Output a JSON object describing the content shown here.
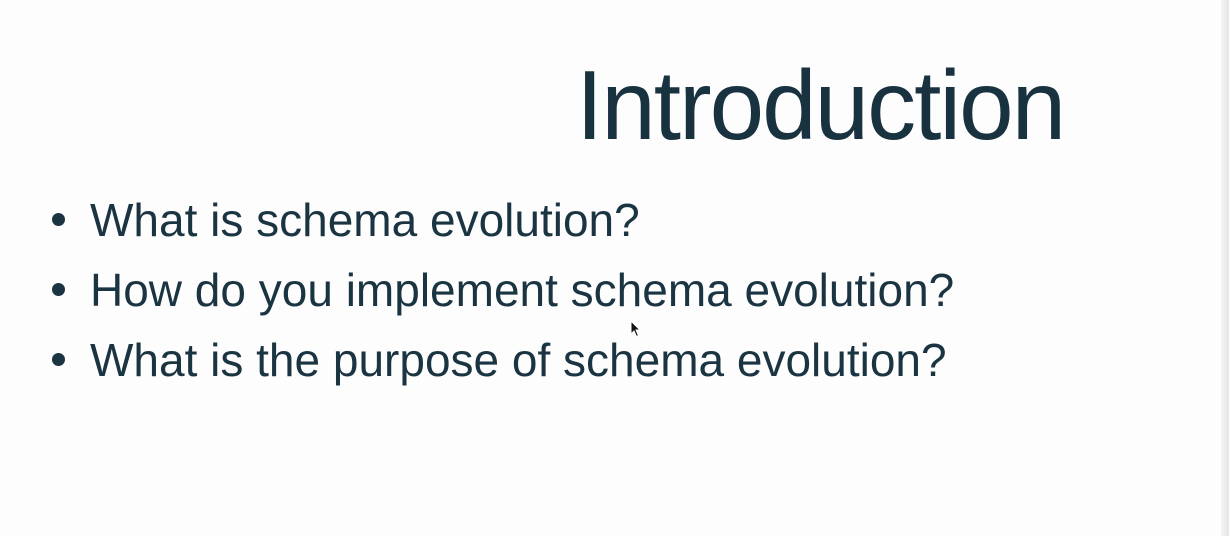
{
  "slide": {
    "title": "Introduction",
    "bullets": [
      "What is schema evolution?",
      "How do you implement schema evolution?",
      "What is the purpose of schema evolution?"
    ]
  },
  "colors": {
    "background": "#fdfdfd",
    "text": "#1b3442"
  },
  "icons": {
    "cursor": "mouse-pointer-icon"
  }
}
